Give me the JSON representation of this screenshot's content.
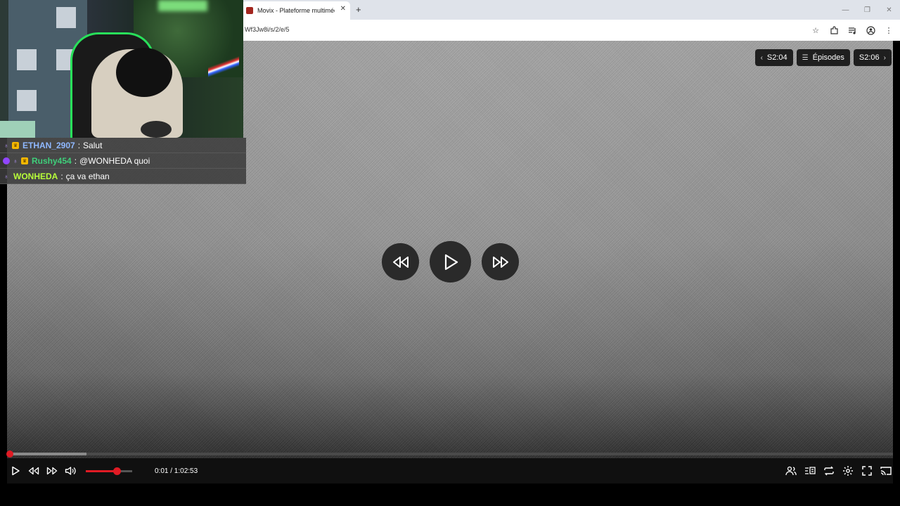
{
  "browser": {
    "tab_title": "Movix - Plateforme multimédia",
    "new_tab": "+",
    "url": "Wf3Jw8i/s/2/e/5",
    "window_controls": [
      "—",
      "❐",
      "✕"
    ]
  },
  "player": {
    "prev_episode": "S2:04",
    "episodes_label": "Épisodes",
    "next_episode": "S2:06",
    "time_display": "0:01 / 1:02:53",
    "volume_level": 0.66,
    "progress_played": 0.001,
    "progress_buffered": 0.09
  },
  "chat": {
    "messages": [
      {
        "user": "ETHAN_2907",
        "separator": ":",
        "text": "Salut",
        "color": "#8fb8ff"
      },
      {
        "user": "Rushy454",
        "separator": ":",
        "text": "@WONHEDA quoi",
        "color": "#3fcf7a"
      },
      {
        "user": "WONHEDA",
        "separator": ":",
        "text": "ça va ethan",
        "color": "#b8ff3a"
      }
    ]
  },
  "colors": {
    "accent": "#e01b24",
    "control_bg": "#1f1f1f"
  },
  "icons": [
    "star-icon",
    "extensions-icon",
    "media-control-icon",
    "profile-icon",
    "menu-icon",
    "play-icon",
    "rewind-icon",
    "forward-icon",
    "volume-icon",
    "watch-party-icon",
    "subtitles-icon",
    "loop-icon",
    "settings-icon",
    "fullscreen-icon",
    "cast-icon"
  ]
}
